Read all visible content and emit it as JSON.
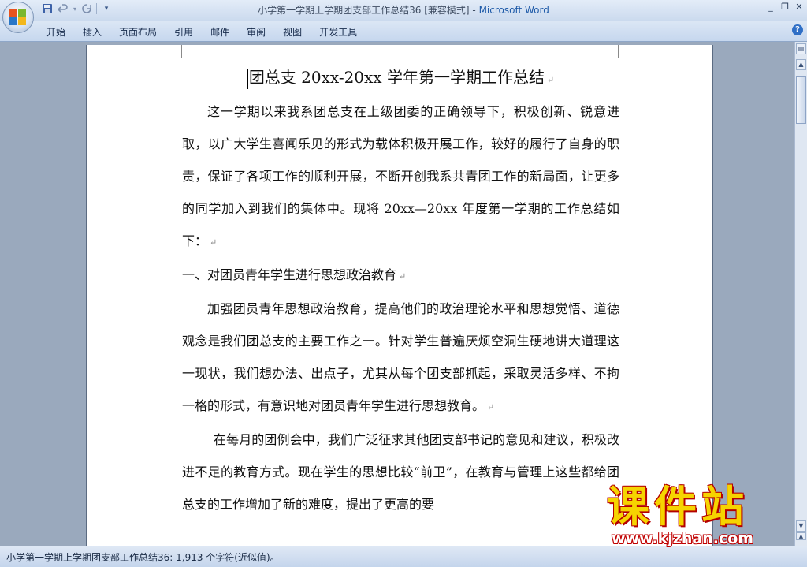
{
  "window": {
    "title": "小学第一学期上学期团支部工作总结36 [兼容模式]",
    "app_separator": " - ",
    "app_name": "Microsoft Word"
  },
  "ribbon": {
    "tabs": [
      {
        "label": "开始"
      },
      {
        "label": "插入"
      },
      {
        "label": "页面布局"
      },
      {
        "label": "引用"
      },
      {
        "label": "邮件"
      },
      {
        "label": "审阅"
      },
      {
        "label": "视图"
      },
      {
        "label": "开发工具"
      }
    ],
    "help_label": "?"
  },
  "document": {
    "title": "团总支 20xx-20xx 学年第一学期工作总结",
    "paragraphs": [
      {
        "text": "这一学期以来我系团总支在上级团委的正确领导下，积极创新、锐意进取，以广大学生喜闻乐见的形式为载体积极开展工作，较好的履行了自身的职责，保证了各项工作的顺利开展，不断开创我系共青团工作的新局面，让更多的同学加入到我们的集体中。现将 20xx—20xx 年度第一学期的工作总结如下："
      },
      {
        "text": "一、对团员青年学生进行思想政治教育"
      },
      {
        "text": "加强团员青年思想政治教育，提高他们的政治理论水平和思想觉悟、道德观念是我们团总支的主要工作之一。针对学生普遍厌烦空洞生硬地讲大道理这一现状，我们想办法、出点子，尤其从每个团支部抓起，采取灵活多样、不拘一格的形式，有意识地对团员青年学生进行思想教育。"
      },
      {
        "text": "在每月的团例会中，我们广泛征求其他团支部书记的意见和建议，积极改进不足的教育方式。现在学生的思想比较“前卫”，在教育与管理上这些都给团总支的工作增加了新的难度，提出了更高的要"
      }
    ],
    "paragraph_mark": "↵"
  },
  "watermark": {
    "main": "课件站",
    "url": "www.kjzhan.com"
  },
  "status": {
    "text": "小学第一学期上学期团支部工作总结36: 1,913 个字符(近似值)。"
  },
  "colors": {
    "accent": "#1e5aa8",
    "workspace": "#9aa9bd",
    "watermark_yellow": "#f6d400",
    "watermark_red": "#b40000"
  },
  "icons": {
    "office_button": "office-logo-icon",
    "save": "save-icon",
    "undo": "undo-icon",
    "redo": "redo-icon",
    "customize": "qat-dropdown-icon"
  }
}
